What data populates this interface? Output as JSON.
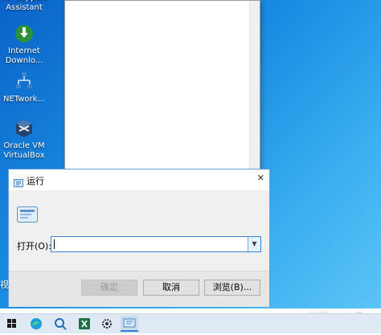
{
  "desktop": {
    "icons": [
      {
        "label": "FIP Support\nAssistant"
      },
      {
        "label": "Internet\nDownlo..."
      },
      {
        "label": "NETwork..."
      },
      {
        "label": "Oracle VM\nVirtualBox"
      }
    ],
    "side_char": "视"
  },
  "run_dialog": {
    "title": "运行",
    "open_label": "打开(O):",
    "command_value": "",
    "ok_label": "确定",
    "cancel_label": "取消",
    "browse_label": "浏览(B)...",
    "close_glyph": "✕"
  },
  "watermark": "知乎 @九月",
  "taskbar": {
    "items": [
      "windows-start-icon",
      "edge-icon",
      "search-icon",
      "excel-icon",
      "settings-icon",
      "run-icon"
    ],
    "accent": "#2f7fd1"
  },
  "colors": {
    "desktop_blue": "#1a8fe3",
    "dialog_border": "#6e9dd8"
  }
}
